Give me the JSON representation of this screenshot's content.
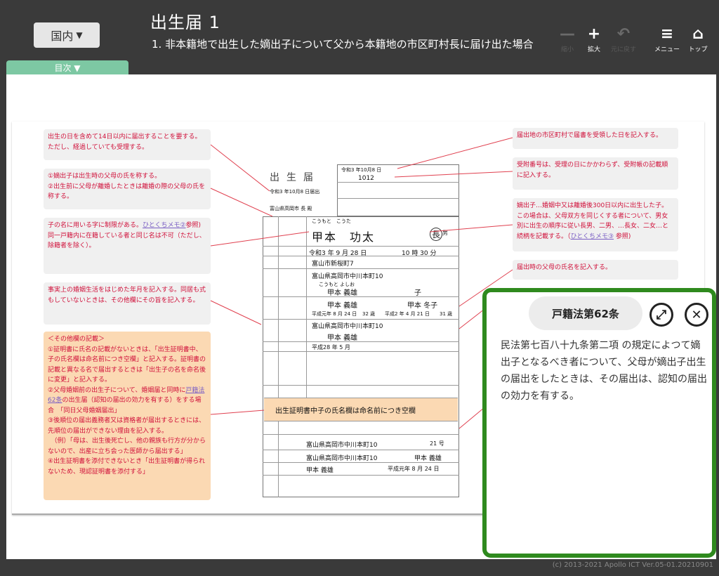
{
  "header": {
    "region_button": "国内",
    "region_arrow": "▼",
    "title": "出生届 1",
    "subtitle": "1. 非本籍地で出生した嫡出子について父から本籍地の市区町村長に届け出た場合",
    "toc_tab": "目次 ▼",
    "tools": [
      {
        "glyph": "—",
        "label": "縮小",
        "icon": "zoom-out-icon",
        "enabled": false
      },
      {
        "glyph": "+",
        "label": "拡大",
        "icon": "zoom-in-icon",
        "enabled": true
      },
      {
        "glyph": "↶",
        "label": "元に戻す",
        "icon": "undo-icon",
        "enabled": false
      },
      {
        "glyph": "≡",
        "label": "メニュー",
        "icon": "menu-icon",
        "enabled": true
      },
      {
        "glyph": "⌂",
        "label": "トップ",
        "icon": "home-icon",
        "enabled": true
      }
    ]
  },
  "notes_left": [
    "出生の日を含めて14日以内に届出することを要する。ただし、経過していても受理する。",
    "①嫡出子は出生時の父母の氏を称する。\n②出生前に父母が離婚したときは離婚の際の父母の氏を称する。",
    "子の名に用いる字に制限がある。",
    "ひとくちメモ②",
    "参照)\n同一戸籍内に在籍している者と同じ名は不可（ただし、除籍者を除く）。",
    "事実上の婚姻生活をはじめた年月を記入する。同居も式もしていないときは、その他欄にその旨を記入する。"
  ],
  "note_other": {
    "heading": "＜その他欄の記載＞",
    "item1": "①証明書に氏名の記載がないときは、「出生証明書中、子の氏名欄は命名前につき空欄」と記入する。証明書の記載と異なる名で届出するときは「出生子の名を命名後に変更」と記入する。",
    "item2a": "②父母婚姻前の出生子について、婚姻届と同時に",
    "item2_link": "戸籍法62条",
    "item2b": "の出生届（認知の届出の効力を有する）をする場合　「同日父母婚姻届出」",
    "item3": "③後順位の届出義務者又は資格者が届出するときには、先順位の届出ができない理由を記入する。\n　（例）「母は、出生後死亡し、他の親族も行方が分からないので、出産に立ち会った医師から届出する」",
    "item4": "④出生証明書を添付できないとき「出生証明書が得られないため、現認証明書を添付する」"
  },
  "notes_right": [
    "届出地の市区町村で届書を受領した日を記入する。",
    "受附番号は、受理の日にかかわらず、受附帳の記載順に記入する。",
    "嫡出子…婚姻中又は離婚後300日以内に出生した子。この場合は、父母双方を同じくする者について、男女別に出生の順序に従い長男、二男、…長女、二女…と続柄を記載する。（",
    "ひとくちメモ③",
    " 参照)",
    "届出時の父母の氏名を記入する。"
  ],
  "form": {
    "title": "出生届",
    "date": "令和3 年10月8 日届出",
    "addressee": "富山県高岡市 長 殿",
    "received": "令和3 年10月8 日",
    "number": "1012",
    "child_kana": "こうもと　こうた",
    "child_name": "甲本　功太",
    "relation": "長",
    "relation_suffix": "男",
    "birth_date": "令和3 年 9 月 28 日",
    "birth_time": "10 時 30 分",
    "birth_place": "富山市新桜町7",
    "address": "富山県高岡市中川本町10",
    "hh_kana": "こうもと よしお",
    "householder": "甲本 義雄",
    "child_rel": "子",
    "father": "甲本 義雄",
    "mother": "甲本 冬子",
    "father_dob": "平成元年 8 月 24 日",
    "father_age": "32 歳",
    "mother_dob": "平成2 年 4 月 21 日",
    "mother_age": "31 歳",
    "honseki": "富山県高岡市中川本町10",
    "head": "甲本 義雄",
    "cohab": "平成28 年 5 月",
    "other_text": "出生証明書中子の氏名欄は命名前につき空欄",
    "notifier_addr": "富山県高岡市中川本町10",
    "notifier_age": "21 号",
    "notifier_honseki": "富山県高岡市中川本町10",
    "notifier_head": "甲本 義雄",
    "notifier_name": "甲本 義雄",
    "notifier_dob": "平成元年 8 月 24 日"
  },
  "popup": {
    "title": "戸籍法第62条",
    "expand_icon": "⤢",
    "close_icon": "✕",
    "body": "民法第七百八十九条第二項 の規定によつて嫡出子となるべき者について、父母が嫡出子出生の届出をしたときは、その届出は、認知の届出の効力を有する。"
  },
  "footer": {
    "copyright": "(c) 2013-2021 Apollo ICT  Ver.05-01.20210901"
  }
}
